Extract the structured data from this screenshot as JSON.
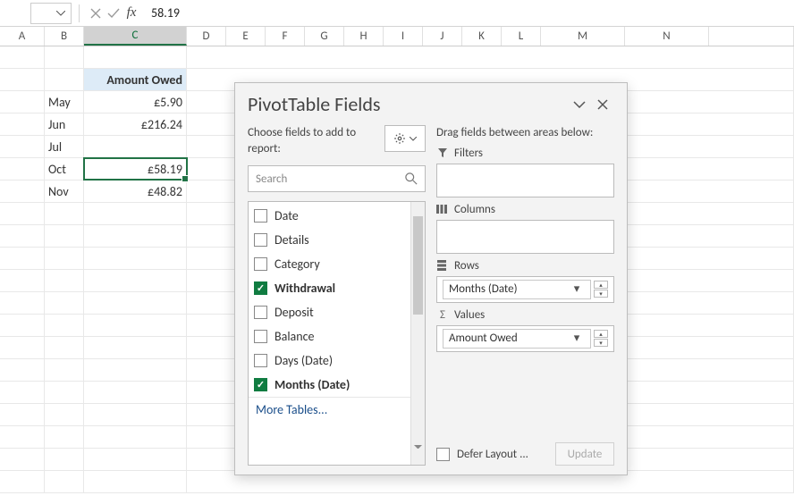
{
  "formula_bar": {
    "value": "58.19",
    "fx": "fx"
  },
  "columns": [
    "A",
    "B",
    "C",
    "D",
    "E",
    "F",
    "G",
    "H",
    "I",
    "J",
    "K",
    "L",
    "M",
    "N"
  ],
  "selected_column": "C",
  "table": {
    "header": "Amount Owed",
    "rows": [
      {
        "label": "May",
        "value": "£5.90"
      },
      {
        "label": "Jun",
        "value": "£216.24"
      },
      {
        "label": "Jul",
        "value": ""
      },
      {
        "label": "Oct",
        "value": "£58.19"
      },
      {
        "label": "Nov",
        "value": "£48.82"
      }
    ],
    "selected_row_index": 3
  },
  "panel": {
    "title": "PivotTable Fields",
    "left_sub": "Choose fields to add to report:",
    "right_sub": "Drag fields between areas below:",
    "search_placeholder": "Search",
    "fields": [
      {
        "label": "Date",
        "checked": false
      },
      {
        "label": "Details",
        "checked": false
      },
      {
        "label": "Category",
        "checked": false
      },
      {
        "label": "Withdrawal",
        "checked": true
      },
      {
        "label": "Deposit",
        "checked": false
      },
      {
        "label": "Balance",
        "checked": false
      },
      {
        "label": "Days (Date)",
        "checked": false
      },
      {
        "label": "Months (Date)",
        "checked": true
      }
    ],
    "more_tables": "More Tables...",
    "areas": {
      "filters": "Filters",
      "columns": "Columns",
      "rows": "Rows",
      "rows_value": "Months (Date)",
      "values": "Values",
      "values_value": "Amount Owed"
    },
    "defer": "Defer Layout ...",
    "update": "Update"
  }
}
